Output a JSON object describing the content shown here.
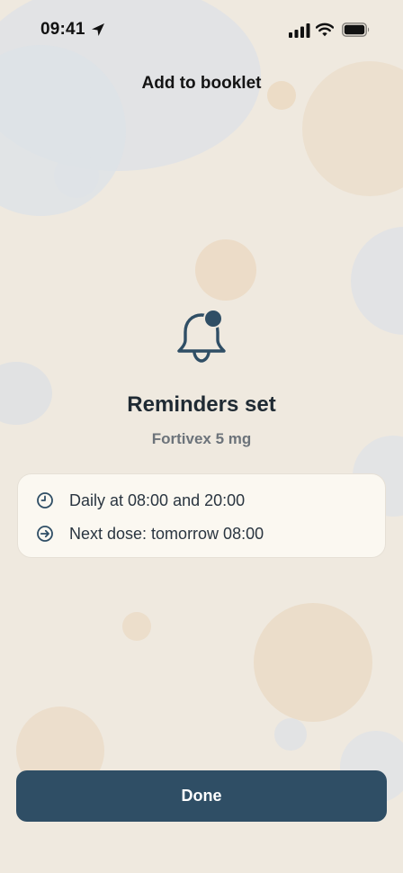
{
  "status_bar": {
    "time": "09:41",
    "icons": [
      "location-arrow-icon",
      "signal-icon",
      "wifi-icon",
      "battery-icon"
    ]
  },
  "nav": {
    "title": "Add to booklet"
  },
  "hero": {
    "icon": "bell-with-badge-icon",
    "title": "Reminders set",
    "subtitle": "Fortivex 5 mg"
  },
  "info_card": {
    "rows": [
      {
        "icon": "clock-icon",
        "text": "Daily at 08:00 and 20:00"
      },
      {
        "icon": "arrow-circle-right-icon",
        "text": "Next dose: tomorrow 08:00"
      }
    ]
  },
  "footer": {
    "done_label": "Done"
  },
  "colors": {
    "background": "#efe9df",
    "accent": "#2f4e65",
    "card": "#fbf8f1",
    "text_primary": "#1f2a33",
    "text_secondary": "#6c737a"
  }
}
